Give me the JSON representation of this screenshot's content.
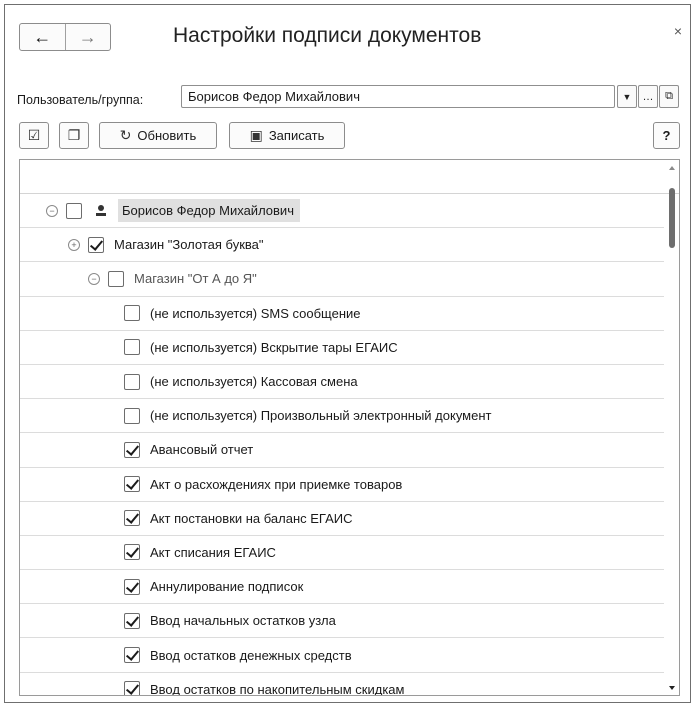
{
  "window": {
    "title": "Настройки подписи документов",
    "close_glyph": "×",
    "back_glyph": "←",
    "forward_glyph": "→"
  },
  "user_field": {
    "label": "Пользователь/группа:",
    "value": "Борисов Федор Михайлович"
  },
  "toolbar": {
    "refresh_label": "Обновить",
    "save_label": "Записать",
    "help_label": "?"
  },
  "tree": {
    "root": {
      "label": "Борисов Федор Михайлович",
      "checked": false
    },
    "stores": [
      {
        "label": "Магазин \"Золотая буква\"",
        "checked": true,
        "expanded": false
      },
      {
        "label": "Магазин \"От А до Я\"",
        "checked": false,
        "expanded": true
      }
    ],
    "documents": [
      {
        "label": "(не используется) SMS сообщение",
        "checked": false
      },
      {
        "label": "(не используется) Вскрытие тары ЕГАИС",
        "checked": false
      },
      {
        "label": "(не используется) Кассовая смена",
        "checked": false
      },
      {
        "label": "(не используется) Произвольный электронный документ",
        "checked": false
      },
      {
        "label": "Авансовый отчет",
        "checked": true
      },
      {
        "label": "Акт о расхождениях при приемке товаров",
        "checked": true
      },
      {
        "label": "Акт постановки на баланс ЕГАИС",
        "checked": true
      },
      {
        "label": "Акт списания ЕГАИС",
        "checked": true
      },
      {
        "label": "Аннулирование подписок",
        "checked": true
      },
      {
        "label": "Ввод начальных остатков узла",
        "checked": true
      },
      {
        "label": "Ввод остатков денежных средств",
        "checked": true
      },
      {
        "label": "Ввод остатков по накопительным скидкам",
        "checked": true
      }
    ]
  }
}
